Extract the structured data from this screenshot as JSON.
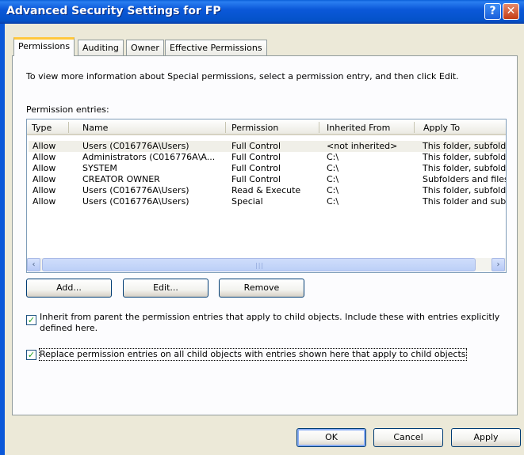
{
  "window": {
    "title": "Advanced Security Settings for FP",
    "help_glyph": "?",
    "close_glyph": "✕"
  },
  "tabs": [
    {
      "label": "Permissions",
      "active": true
    },
    {
      "label": "Auditing",
      "active": false
    },
    {
      "label": "Owner",
      "active": false
    },
    {
      "label": "Effective Permissions",
      "active": false
    }
  ],
  "info_text": "To view more information about Special permissions, select a permission entry, and then click Edit.",
  "entries_label": "Permission entries:",
  "columns": [
    "Type",
    "Name",
    "Permission",
    "Inherited From",
    "Apply To"
  ],
  "rows": [
    [
      "Allow",
      "Users (C016776A\\Users)",
      "Full Control",
      "<not inherited>",
      "This folder, subfold"
    ],
    [
      "Allow",
      "Administrators (C016776A\\A...",
      "Full Control",
      "C:\\",
      "This folder, subfold"
    ],
    [
      "Allow",
      "SYSTEM",
      "Full Control",
      "C:\\",
      "This folder, subfold"
    ],
    [
      "Allow",
      "CREATOR OWNER",
      "Full Control",
      "C:\\",
      "Subfolders and files"
    ],
    [
      "Allow",
      "Users (C016776A\\Users)",
      "Read & Execute",
      "C:\\",
      "This folder, subfold"
    ],
    [
      "Allow",
      "Users (C016776A\\Users)",
      "Special",
      "C:\\",
      "This folder and sub"
    ]
  ],
  "scroll": {
    "left_glyph": "‹",
    "right_glyph": "›",
    "grip": "|||"
  },
  "actions": {
    "add": "Add...",
    "edit": "Edit...",
    "remove": "Remove"
  },
  "inherit_checkbox": {
    "checked": true,
    "line1": "Inherit from parent the permission entries that apply to child objects. Include these with entries explicitly",
    "line2": "defined here."
  },
  "replace_checkbox": {
    "checked": true,
    "label": "Replace permission entries on all child objects with entries shown here that apply to child objects"
  },
  "footer": {
    "ok": "OK",
    "cancel": "Cancel",
    "apply": "Apply"
  },
  "check_glyph": "✓"
}
